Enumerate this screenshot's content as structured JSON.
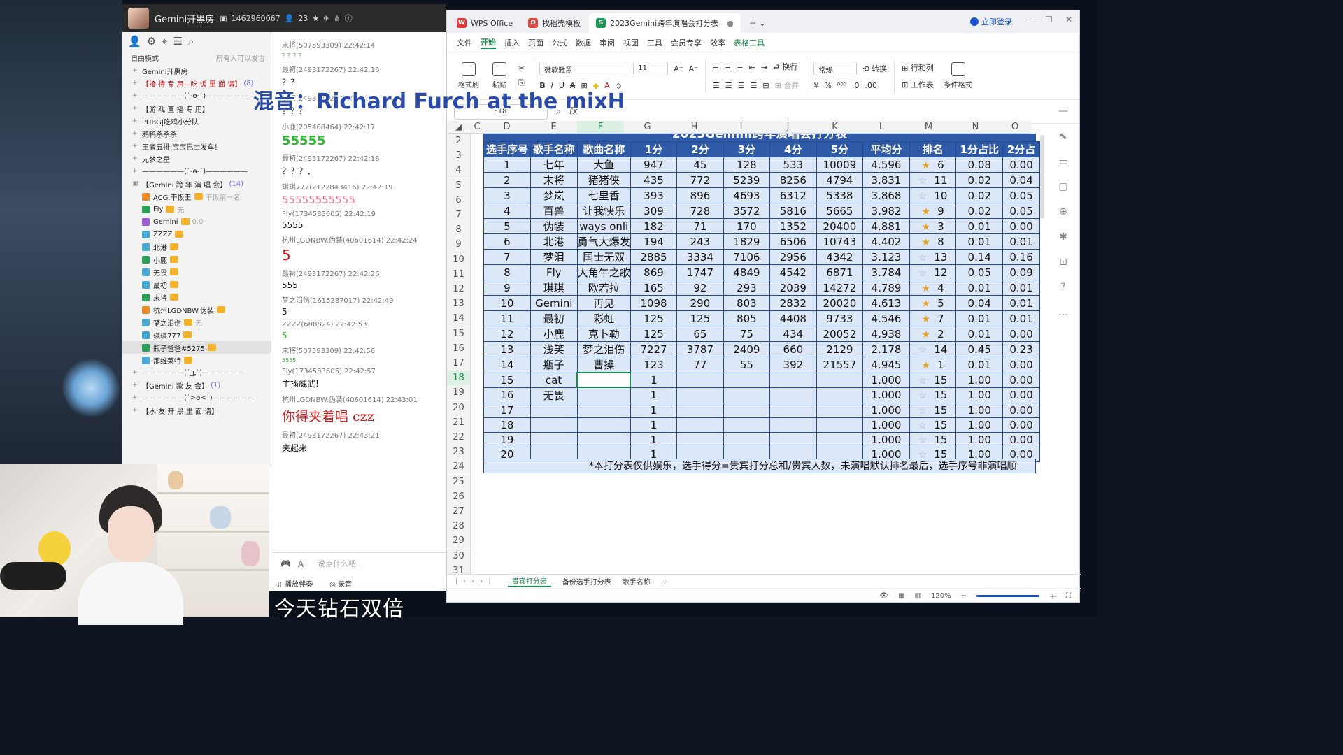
{
  "qq": {
    "room_name": "Gemini开黑房",
    "room_id": "1462960067",
    "member_count": "23",
    "mode": "自由模式",
    "mode_hint": "所有人可以发言",
    "channels": [
      {
        "text": "Gemini开黑房",
        "style": "top"
      },
      {
        "text": "【接 待 专 用—吃 饭 里 面 请】",
        "count": "(8)",
        "style": "red"
      },
      {
        "text": "——————(˙-ө-˙)——————",
        "style": ""
      },
      {
        "text": "【游 戏 直 播 专 用】",
        "style": ""
      },
      {
        "text": "PUBG|吃鸡小分队",
        "style": ""
      },
      {
        "text": "鹅鸭杀杀杀",
        "style": ""
      },
      {
        "text": "王者五排|宝宝巴士发车！",
        "style": ""
      },
      {
        "text": "元梦之星",
        "style": ""
      },
      {
        "text": "——————(`-ө-´)——————",
        "style": ""
      },
      {
        "text": "【Gemini 跨 年 演 唱 会】",
        "count": "(14)",
        "style": ""
      }
    ],
    "users": [
      {
        "name": "ACG.干饭王",
        "tag": "干饭第一名",
        "color": "o"
      },
      {
        "name": "Fly",
        "tag": "无",
        "color": "g"
      },
      {
        "name": "Gemini",
        "tag": "0.0",
        "color": "p"
      },
      {
        "name": "ZZZZ",
        "tag": "",
        "color": ""
      },
      {
        "name": "北港",
        "tag": "",
        "color": ""
      },
      {
        "name": "小鹿",
        "tag": "",
        "color": "g"
      },
      {
        "name": "无畏",
        "tag": "",
        "color": ""
      },
      {
        "name": "最初",
        "tag": "",
        "color": ""
      },
      {
        "name": "末将",
        "tag": "",
        "color": "g"
      },
      {
        "name": "杭州LGDNBW.伪装",
        "tag": "",
        "color": "o"
      },
      {
        "name": "梦之泪伤",
        "tag": "无",
        "color": ""
      },
      {
        "name": "琪琪777",
        "tag": "",
        "color": ""
      },
      {
        "name": "瓶子爸爸#5275",
        "tag": "",
        "color": "g"
      },
      {
        "name": "那维莱特",
        "tag": "",
        "color": ""
      }
    ],
    "channels_after": [
      {
        "text": "——————(˙ ͜ʟ˙)——————"
      },
      {
        "text": "【Gemini 歌 友 会】",
        "count": "(1)"
      },
      {
        "text": "——————(˙>ө<˙)——————"
      },
      {
        "text": "【水 友 开 黑 里 面 请】"
      }
    ],
    "messages": [
      {
        "head": "末将(507593309)  22:42:14",
        "body": "？？？？",
        "style": "small"
      },
      {
        "head": "最初(2493172267)  22:42:16",
        "body": "？？",
        "style": ""
      },
      {
        "head": "最初(2493172267)  22:42:17",
        "body": "？？？",
        "style": ""
      },
      {
        "head": "小鹿(205468464)  22:42:17",
        "body": "55555",
        "style": "big green"
      },
      {
        "head": "最初(2493172267)  22:42:18",
        "body": "？？？、",
        "style": ""
      },
      {
        "head": "琪琪777(2122843416)  22:42:19",
        "body": "55555555555",
        "style": "pink"
      },
      {
        "head": "Fly(1734583605)  22:42:19",
        "body": "5555",
        "style": ""
      },
      {
        "head": "杭州LGDNBW.伪装(40601614)  22:42:24",
        "body": "5",
        "style": "red"
      },
      {
        "head": "最初(2493172267)  22:42:26",
        "body": "555",
        "style": ""
      },
      {
        "head": "梦之泪伤(1615287017)  22:42:49",
        "body": "5",
        "style": ""
      },
      {
        "head": "ZZZZ(688824)  22:42:53",
        "body": "5",
        "style": "green"
      },
      {
        "head": "末将(507593309)  22:42:56",
        "body": "5555",
        "style": "small"
      },
      {
        "head": "Fly(1734583605)  22:42:57",
        "body": "主播威武!",
        "style": ""
      },
      {
        "head": "杭州LGDNBW.伪装(40601614)  22:43:01",
        "body": "你得夹着唱 czz",
        "style": "redbig"
      },
      {
        "head": "最初(2493172267)  22:43:21",
        "body": "夹起来",
        "style": ""
      }
    ],
    "input_placeholder": "说点什么吧...",
    "music_label": "播放伴奏",
    "record_label": "录音"
  },
  "caption": "今天钻石双倍",
  "overlay": "混音：Richard Furch at the mixH",
  "wps": {
    "tabs": [
      "WPS Office",
      "找稻壳模板",
      "2023Gemini跨年演唱会打分表"
    ],
    "login": "立即登录",
    "menu": [
      "文件",
      "开始",
      "插入",
      "页面",
      "公式",
      "数据",
      "审阅",
      "视图",
      "工具",
      "会员专享",
      "效率",
      "表格工具"
    ],
    "ribbon": {
      "format_painter": "格式刷",
      "paste": "粘贴",
      "font": "微软雅黑",
      "size": "11",
      "wrap": "换行",
      "merge": "合并",
      "number_format": "常规",
      "convert": "转换",
      "rowcol": "行和列",
      "worksheet": "工作表",
      "cond_format": "条件格式"
    },
    "cell_ref": "F18",
    "fx": "fx",
    "columns": [
      "C",
      "D",
      "E",
      "F",
      "G",
      "H",
      "I",
      "J",
      "K",
      "L",
      "M",
      "N",
      "O"
    ],
    "rows": [
      "2",
      "3",
      "4",
      "5",
      "6",
      "7",
      "8",
      "9",
      "10",
      "11",
      "12",
      "13",
      "14",
      "15",
      "16",
      "17",
      "18",
      "19",
      "20",
      "21",
      "22",
      "23",
      "24",
      "25",
      "26",
      "27",
      "28",
      "29",
      "30",
      "31",
      "32"
    ],
    "sheet_title": "2023Gemini跨年演唱会打分表",
    "headers": [
      "选手序号",
      "歌手名称",
      "歌曲名称",
      "1分",
      "2分",
      "3分",
      "4分",
      "5分",
      "平均分",
      "排名",
      "1分占比",
      "2分占"
    ],
    "data": [
      [
        "1",
        "七年",
        "大鱼",
        "947",
        "45",
        "128",
        "533",
        "10009",
        "4.596",
        "6",
        "0.08",
        "0.00",
        "full"
      ],
      [
        "2",
        "末将",
        "猪猪侠",
        "435",
        "772",
        "5239",
        "8256",
        "4794",
        "3.831",
        "11",
        "0.02",
        "0.04",
        "empty"
      ],
      [
        "3",
        "梦岚",
        "七里香",
        "393",
        "896",
        "4693",
        "6312",
        "5338",
        "3.868",
        "10",
        "0.02",
        "0.05",
        "empty"
      ],
      [
        "4",
        "百兽",
        "让我快乐",
        "309",
        "728",
        "3572",
        "5816",
        "5665",
        "3.982",
        "9",
        "0.02",
        "0.05",
        "full"
      ],
      [
        "5",
        "伪装",
        "ways onli",
        "182",
        "71",
        "170",
        "1352",
        "20400",
        "4.881",
        "3",
        "0.01",
        "0.00",
        "full"
      ],
      [
        "6",
        "北港",
        "勇气大爆发",
        "194",
        "243",
        "1829",
        "6506",
        "10743",
        "4.402",
        "8",
        "0.01",
        "0.01",
        "full"
      ],
      [
        "7",
        "梦泪",
        "国士无双",
        "2885",
        "3334",
        "7106",
        "2956",
        "4342",
        "3.123",
        "13",
        "0.14",
        "0.16",
        "empty"
      ],
      [
        "8",
        "Fly",
        "大角牛之歌",
        "869",
        "1747",
        "4849",
        "4542",
        "6871",
        "3.784",
        "12",
        "0.05",
        "0.09",
        "empty"
      ],
      [
        "9",
        "琪琪",
        "欧若拉",
        "165",
        "92",
        "293",
        "2039",
        "14272",
        "4.789",
        "4",
        "0.01",
        "0.01",
        "full"
      ],
      [
        "10",
        "Gemini",
        "再见",
        "1098",
        "290",
        "803",
        "2832",
        "20020",
        "4.613",
        "5",
        "0.04",
        "0.01",
        "full"
      ],
      [
        "11",
        "最初",
        "彩虹",
        "125",
        "125",
        "805",
        "4408",
        "9733",
        "4.546",
        "7",
        "0.01",
        "0.01",
        "full"
      ],
      [
        "12",
        "小鹿",
        "克卜勒",
        "125",
        "65",
        "75",
        "434",
        "20052",
        "4.938",
        "2",
        "0.01",
        "0.00",
        "full"
      ],
      [
        "13",
        "浅笑",
        "梦之泪伤",
        "7227",
        "3787",
        "2409",
        "660",
        "2129",
        "2.178",
        "14",
        "0.45",
        "0.23",
        "empty"
      ],
      [
        "14",
        "瓶子",
        "曹操",
        "123",
        "77",
        "55",
        "392",
        "21557",
        "4.945",
        "1",
        "0.01",
        "0.00",
        "full"
      ],
      [
        "15",
        "cat",
        "",
        "1",
        "",
        "",
        "",
        "",
        "1.000",
        "15",
        "1.00",
        "0.00",
        "empty"
      ],
      [
        "16",
        "无畏",
        "",
        "1",
        "",
        "",
        "",
        "",
        "1.000",
        "15",
        "1.00",
        "0.00",
        "empty"
      ],
      [
        "17",
        "",
        "",
        "1",
        "",
        "",
        "",
        "",
        "1.000",
        "15",
        "1.00",
        "0.00",
        "empty"
      ],
      [
        "18",
        "",
        "",
        "1",
        "",
        "",
        "",
        "",
        "1.000",
        "15",
        "1.00",
        "0.00",
        "empty"
      ],
      [
        "19",
        "",
        "",
        "1",
        "",
        "",
        "",
        "",
        "1.000",
        "15",
        "1.00",
        "0.00",
        "empty"
      ],
      [
        "20",
        "",
        "",
        "1",
        "",
        "",
        "",
        "",
        "1.000",
        "15",
        "1.00",
        "0.00",
        "empty"
      ]
    ],
    "footnote": "*本打分表仅供娱乐，选手得分=贵宾打分总和/贵宾人数，未演唱默认排名最后，选手序号非演唱顺",
    "sheet_tabs": [
      "贵宾打分表",
      "备份选手打分表",
      "歌手名称"
    ],
    "zoom": "120%"
  }
}
